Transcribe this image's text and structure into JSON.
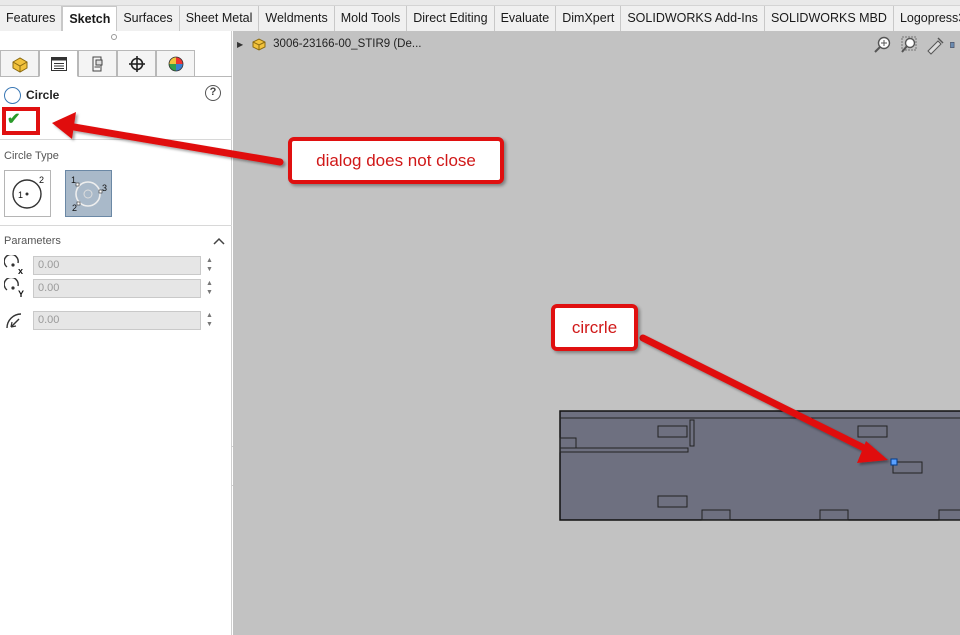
{
  "tabs": [
    {
      "label": "Features",
      "active": false
    },
    {
      "label": "Sketch",
      "active": true
    },
    {
      "label": "Surfaces",
      "active": false
    },
    {
      "label": "Sheet Metal",
      "active": false
    },
    {
      "label": "Weldments",
      "active": false
    },
    {
      "label": "Mold Tools",
      "active": false
    },
    {
      "label": "Direct Editing",
      "active": false
    },
    {
      "label": "Evaluate",
      "active": false
    },
    {
      "label": "DimXpert",
      "active": false
    },
    {
      "label": "SOLIDWORKS Add-Ins",
      "active": false
    },
    {
      "label": "SOLIDWORKS MBD",
      "active": false
    },
    {
      "label": "Logopress3 Sketc",
      "active": false
    }
  ],
  "property_manager": {
    "tab_icons": [
      "feature-manager-icon",
      "property-manager-icon",
      "configuration-manager-icon",
      "dimxpert-manager-icon",
      "display-manager-icon"
    ],
    "title": "Circle",
    "help_icon": "?",
    "ok_icon": "✔",
    "circle_type": {
      "label": "Circle Type",
      "options": [
        "center-circle-icon",
        "perimeter-circle-icon"
      ],
      "selected_index": 1
    },
    "parameters": {
      "label": "Parameters",
      "fields": [
        {
          "name": "center-x",
          "value": "0.00"
        },
        {
          "name": "center-y",
          "value": "0.00"
        },
        {
          "name": "radius",
          "value": "0.00"
        }
      ]
    }
  },
  "viewport": {
    "tree_item": "3006-23166-00_STIR9  (De...",
    "background": "#c2c2c2",
    "part_color": "#6e7080"
  },
  "callouts": {
    "dialog": "dialog does not close",
    "circle": "circrle"
  },
  "accent_color": "#e01010"
}
